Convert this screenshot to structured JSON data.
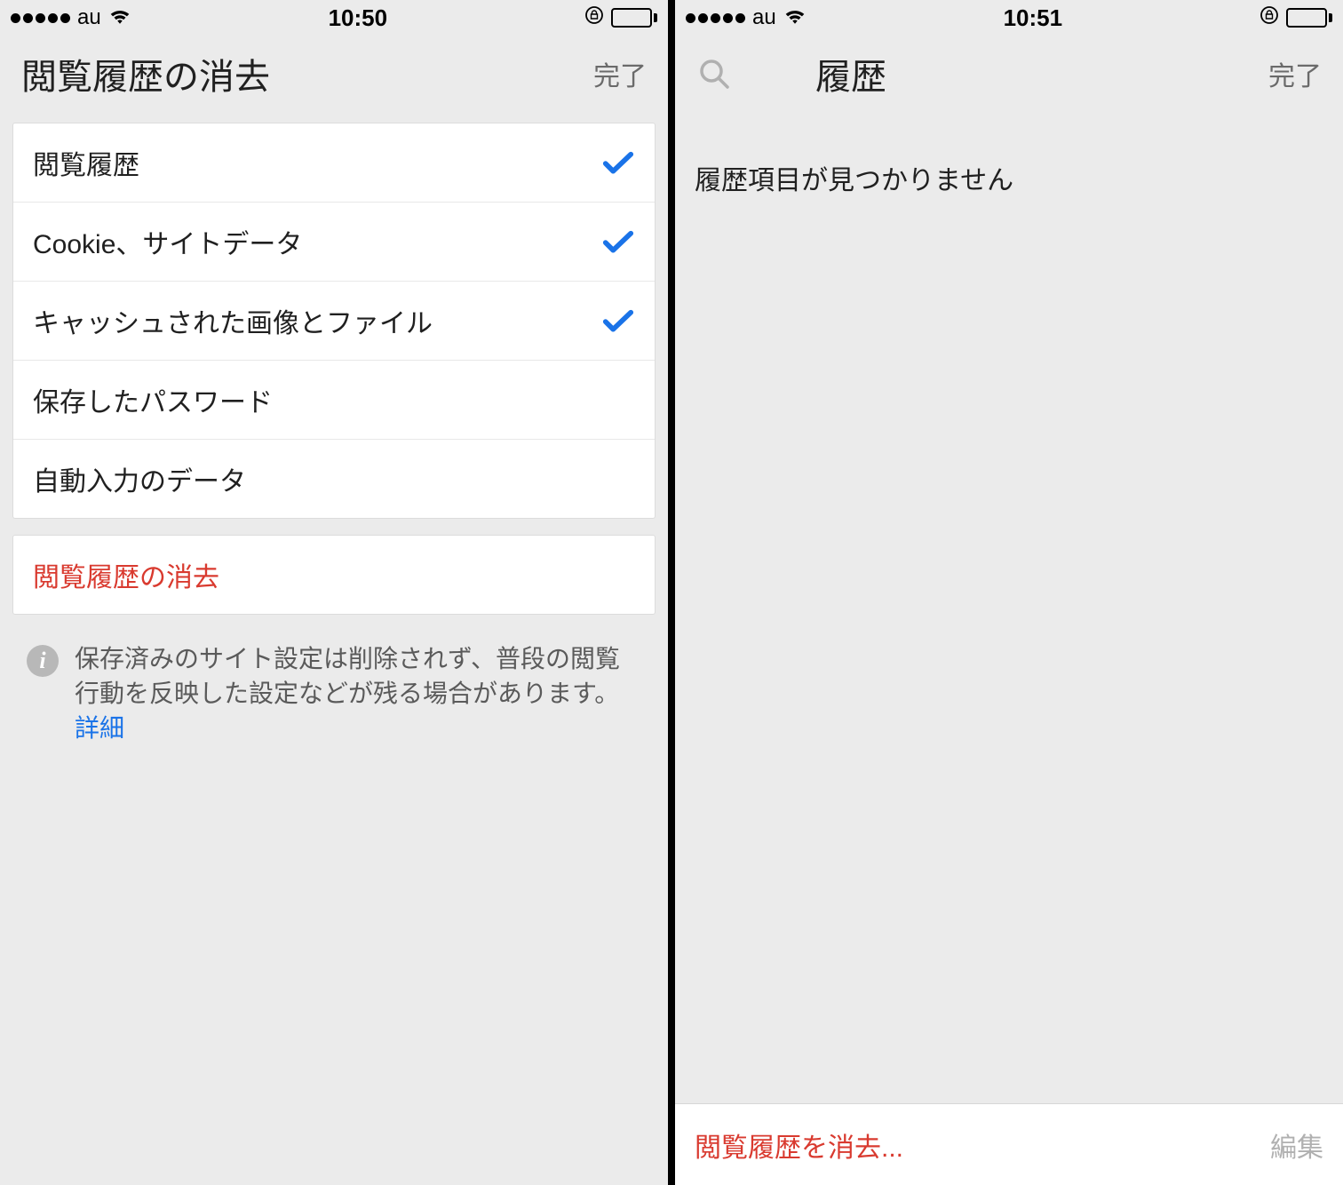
{
  "left": {
    "status": {
      "carrier": "au",
      "time": "10:50"
    },
    "header": {
      "title": "閲覧履歴の消去",
      "done": "完了"
    },
    "items": [
      {
        "label": "閲覧履歴",
        "checked": true
      },
      {
        "label": "Cookie、サイトデータ",
        "checked": true
      },
      {
        "label": "キャッシュされた画像とファイル",
        "checked": true
      },
      {
        "label": "保存したパスワード",
        "checked": false
      },
      {
        "label": "自動入力のデータ",
        "checked": false
      }
    ],
    "clear_action": "閲覧履歴の消去",
    "note": {
      "text": "保存済みのサイト設定は削除されず、普段の閲覧行動を反映した設定などが残る場合があります。",
      "link": "詳細"
    }
  },
  "right": {
    "status": {
      "carrier": "au",
      "time": "10:51"
    },
    "header": {
      "title": "履歴",
      "done": "完了"
    },
    "empty": "履歴項目が見つかりません",
    "toolbar": {
      "clear": "閲覧履歴を消去...",
      "edit": "編集"
    }
  }
}
